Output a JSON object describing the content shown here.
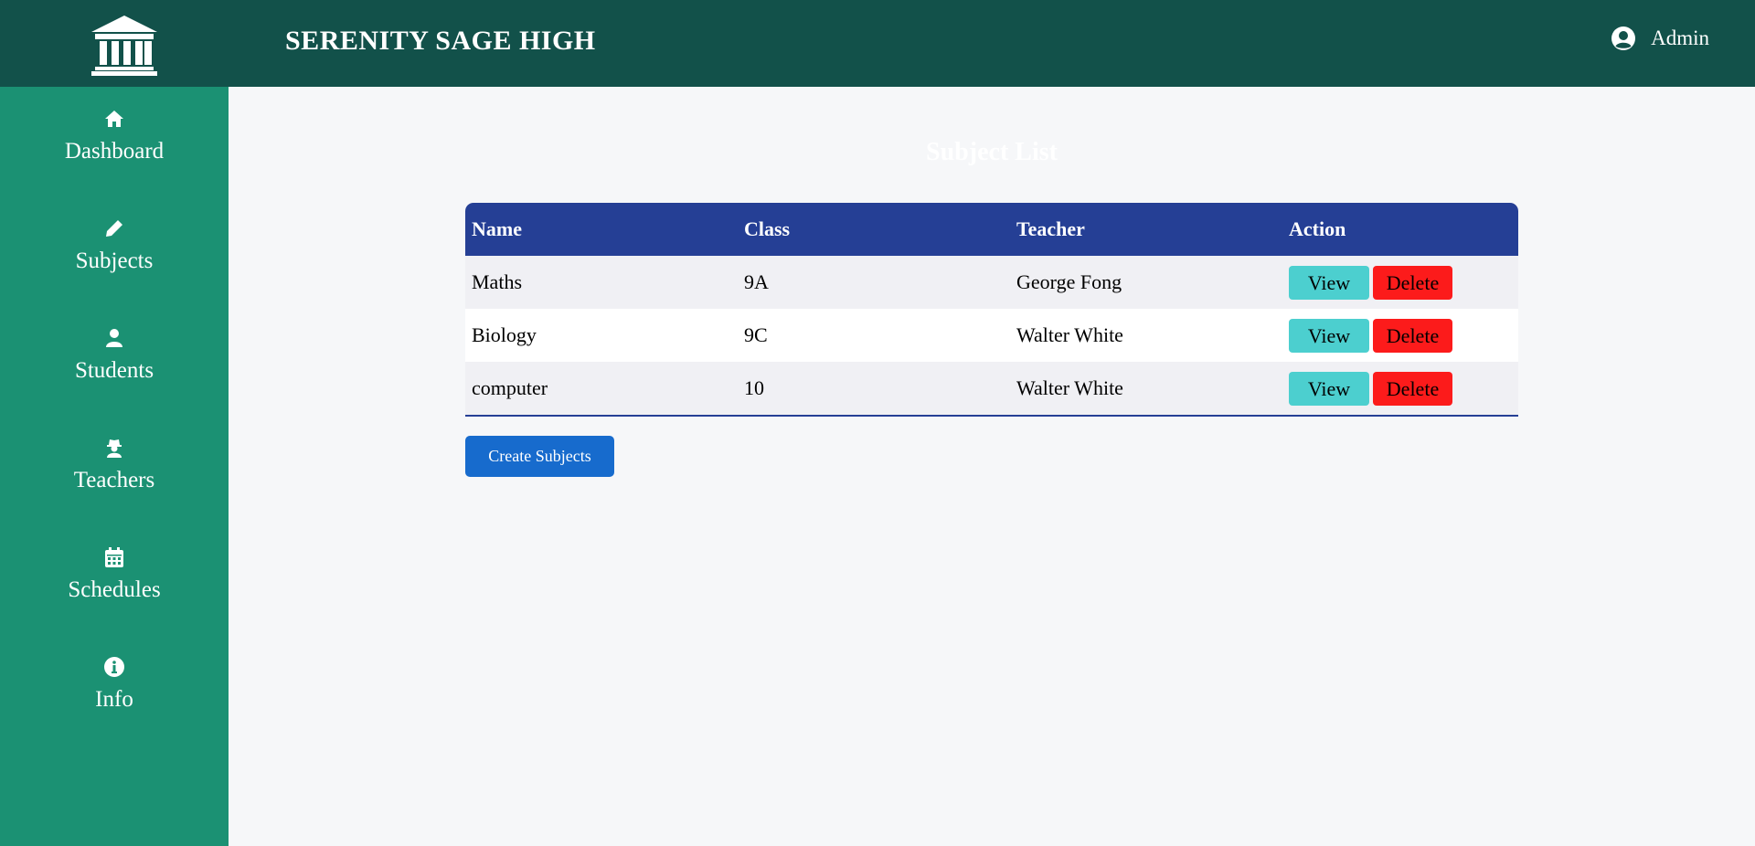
{
  "header": {
    "school_name": "SERENITY SAGE HIGH",
    "user_label": "Admin"
  },
  "sidebar": {
    "items": [
      {
        "label": "Dashboard",
        "icon": "home-icon"
      },
      {
        "label": "Subjects",
        "icon": "pencil-icon"
      },
      {
        "label": "Students",
        "icon": "user-icon"
      },
      {
        "label": "Teachers",
        "icon": "teacher-icon"
      },
      {
        "label": "Schedules",
        "icon": "calendar-icon"
      },
      {
        "label": "Info",
        "icon": "info-icon"
      }
    ]
  },
  "main": {
    "title": "Subject List",
    "columns": [
      "Name",
      "Class",
      "Teacher",
      "Action"
    ],
    "rows": [
      {
        "name": "Maths",
        "class": "9A",
        "teacher": "George Fong",
        "view": "View",
        "delete": "Delete"
      },
      {
        "name": "Biology",
        "class": "9C",
        "teacher": "Walter White",
        "view": "View",
        "delete": "Delete"
      },
      {
        "name": "computer",
        "class": "10",
        "teacher": "Walter White",
        "view": "View",
        "delete": "Delete"
      }
    ],
    "create_button": "Create Subjects"
  },
  "colors": {
    "header_bg": "#12514a",
    "sidebar_bg": "#1b9173",
    "table_header_bg": "#253f95",
    "view_button": "#4ccfcf",
    "delete_button": "#fc1b1b",
    "create_button": "#176bcd"
  }
}
